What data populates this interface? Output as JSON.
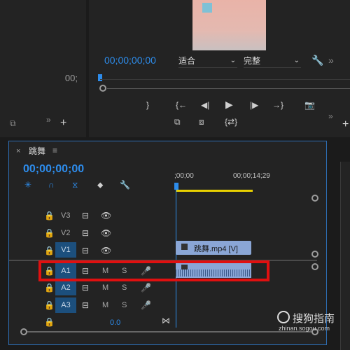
{
  "program_monitor": {
    "timecode": "00;00;00;00",
    "fit_select": "适合",
    "quality_select": "完整",
    "left_timecode": "00;",
    "controls": [
      "mark-out",
      "go-to-in",
      "step-back",
      "play",
      "step-forward",
      "go-to-out",
      "export-frame",
      "lift",
      "extract",
      "comparison"
    ]
  },
  "timeline": {
    "sequence_name": "跳舞",
    "timecode": "00;00;00;00",
    "ruler_start": ";00;00",
    "ruler_mark": "00;00;14;29",
    "video_tracks": [
      {
        "label": "V3",
        "selected": false
      },
      {
        "label": "V2",
        "selected": false
      },
      {
        "label": "V1",
        "selected": true
      }
    ],
    "audio_tracks": [
      {
        "label": "A1",
        "selected": true,
        "m": "M",
        "s": "S"
      },
      {
        "label": "A2",
        "selected": true,
        "m": "M",
        "s": "S"
      },
      {
        "label": "A3",
        "selected": true,
        "m": "M",
        "s": "S"
      }
    ],
    "clip_name": "跳舞.mp4 [V]",
    "master_volume": "0.0"
  },
  "watermark": {
    "brand": "搜狗指南",
    "url": "zhinan.sogou.com"
  },
  "colors": {
    "accent": "#2d8ceb",
    "highlight_box": "#e01010",
    "clip": "#8aa6d6"
  }
}
